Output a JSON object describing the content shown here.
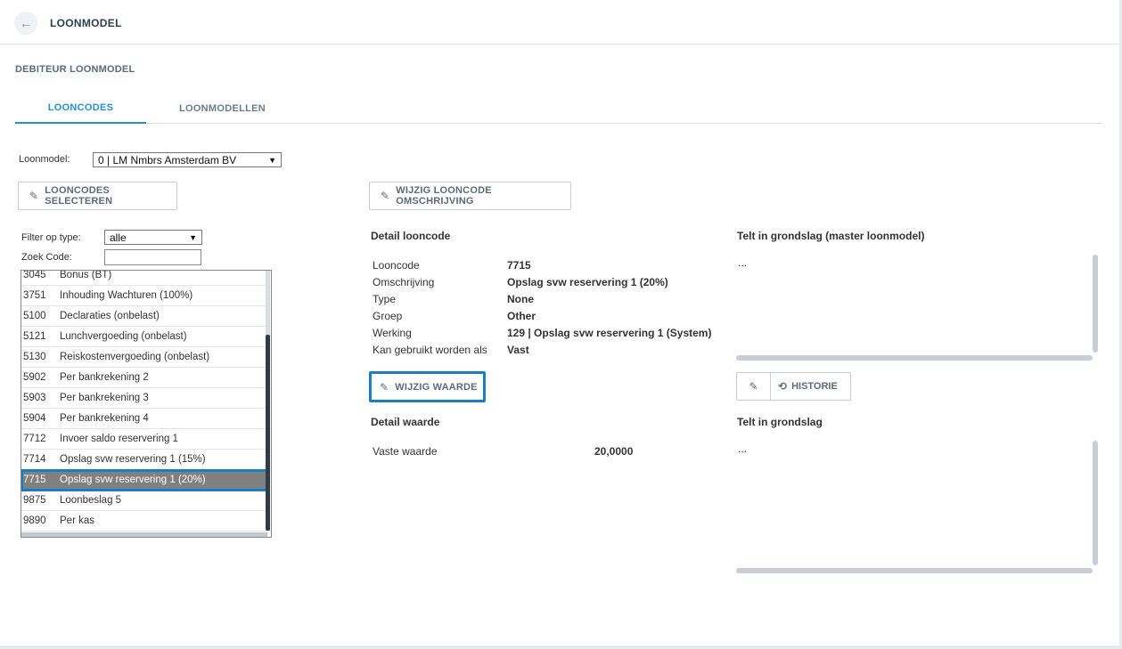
{
  "header": {
    "title": "LOONMODEL"
  },
  "section_title": "DEBITEUR LOONMODEL",
  "tabs": [
    {
      "label": "LOONCODES",
      "active": true
    },
    {
      "label": "LOONMODELLEN",
      "active": false
    }
  ],
  "loonmodel": {
    "label": "Loonmodel:",
    "value": "0 | LM Nmbrs Amsterdam BV"
  },
  "buttons": {
    "looncodes_selecteren": "LOONCODES SELECTEREN",
    "wijzig_omschrijving": "WIJZIG LOONCODE OMSCHRIJVING",
    "wijzig_waarde": "WIJZIG WAARDE",
    "historie": "HISTORIE"
  },
  "filter": {
    "type_label": "Filter op type:",
    "type_value": "alle",
    "zoek_label": "Zoek Code:",
    "zoek_value": ""
  },
  "codes": [
    {
      "code": "3045",
      "name": "Bonus (BT)"
    },
    {
      "code": "3751",
      "name": "Inhouding Wachturen (100%)"
    },
    {
      "code": "5100",
      "name": "Declaraties (onbelast)"
    },
    {
      "code": "5121",
      "name": "Lunchvergoeding (onbelast)"
    },
    {
      "code": "5130",
      "name": "Reiskostenvergoeding (onbelast)"
    },
    {
      "code": "5902",
      "name": "Per bankrekening 2"
    },
    {
      "code": "5903",
      "name": "Per bankrekening 3"
    },
    {
      "code": "5904",
      "name": "Per bankrekening 4"
    },
    {
      "code": "7712",
      "name": "Invoer saldo reservering 1"
    },
    {
      "code": "7714",
      "name": "Opslag svw reservering 1 (15%)"
    },
    {
      "code": "7715",
      "name": "Opslag svw reservering 1 (20%)",
      "selected": true
    },
    {
      "code": "9875",
      "name": "Loonbeslag 5"
    },
    {
      "code": "9890",
      "name": "Per kas"
    }
  ],
  "detail_looncode": {
    "title": "Detail looncode",
    "rows": [
      {
        "label": "Looncode",
        "value": "7715"
      },
      {
        "label": "Omschrijving",
        "value": "Opslag svw reservering 1 (20%)"
      },
      {
        "label": "Type",
        "value": "None"
      },
      {
        "label": "Groep",
        "value": "Other"
      },
      {
        "label": "Werking",
        "value": "129 | Opslag svw reservering 1 (System)"
      },
      {
        "label": "Kan gebruikt worden als",
        "value": "Vast"
      }
    ]
  },
  "detail_waarde": {
    "title": "Detail waarde",
    "label": "Vaste waarde",
    "value": "20,0000"
  },
  "grondslag_master": {
    "title": "Telt in grondslag (master loonmodel)",
    "content": "..."
  },
  "grondslag": {
    "title": "Telt in grondslag",
    "content": "..."
  },
  "colors": {
    "accent": "#2a8fd4",
    "selection_outline": "#1a7fc1",
    "selected_row": "#808080"
  }
}
